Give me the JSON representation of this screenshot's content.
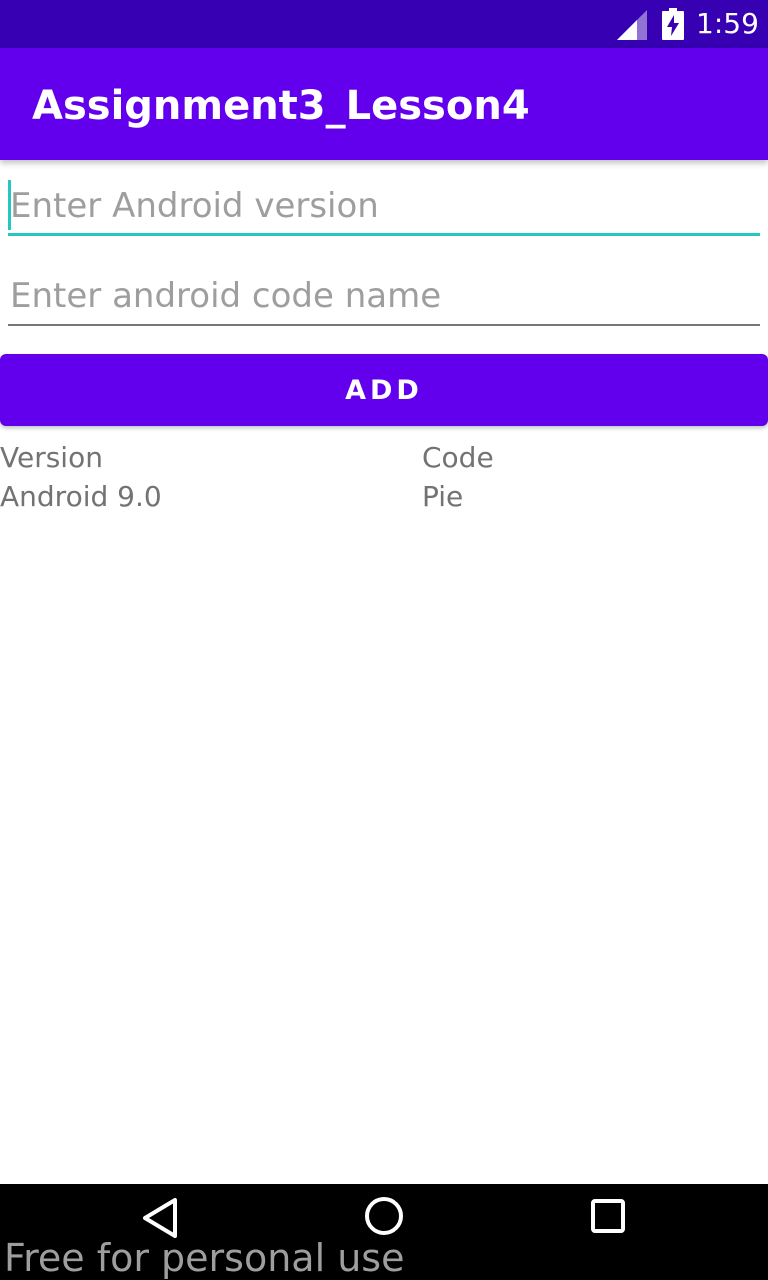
{
  "status_bar": {
    "time": "1:59",
    "icons": [
      "cell-signal-icon",
      "battery-charging-icon"
    ],
    "color": "#3700b3"
  },
  "app_bar": {
    "title": "Assignment3_Lesson4",
    "color": "#6200ee"
  },
  "form": {
    "version_input": {
      "value": "",
      "placeholder": "Enter Android version"
    },
    "code_name_input": {
      "value": "",
      "placeholder": "Enter android code name"
    },
    "add_button_label": "ADD",
    "accent_color": "#26c6c2"
  },
  "table": {
    "headers": [
      "Version",
      "Code"
    ],
    "rows": [
      [
        "Android 9.0",
        "Pie"
      ]
    ]
  },
  "nav_bar": {
    "buttons": [
      "back-icon",
      "home-icon",
      "recents-icon"
    ]
  },
  "watermark": "Free for personal use"
}
